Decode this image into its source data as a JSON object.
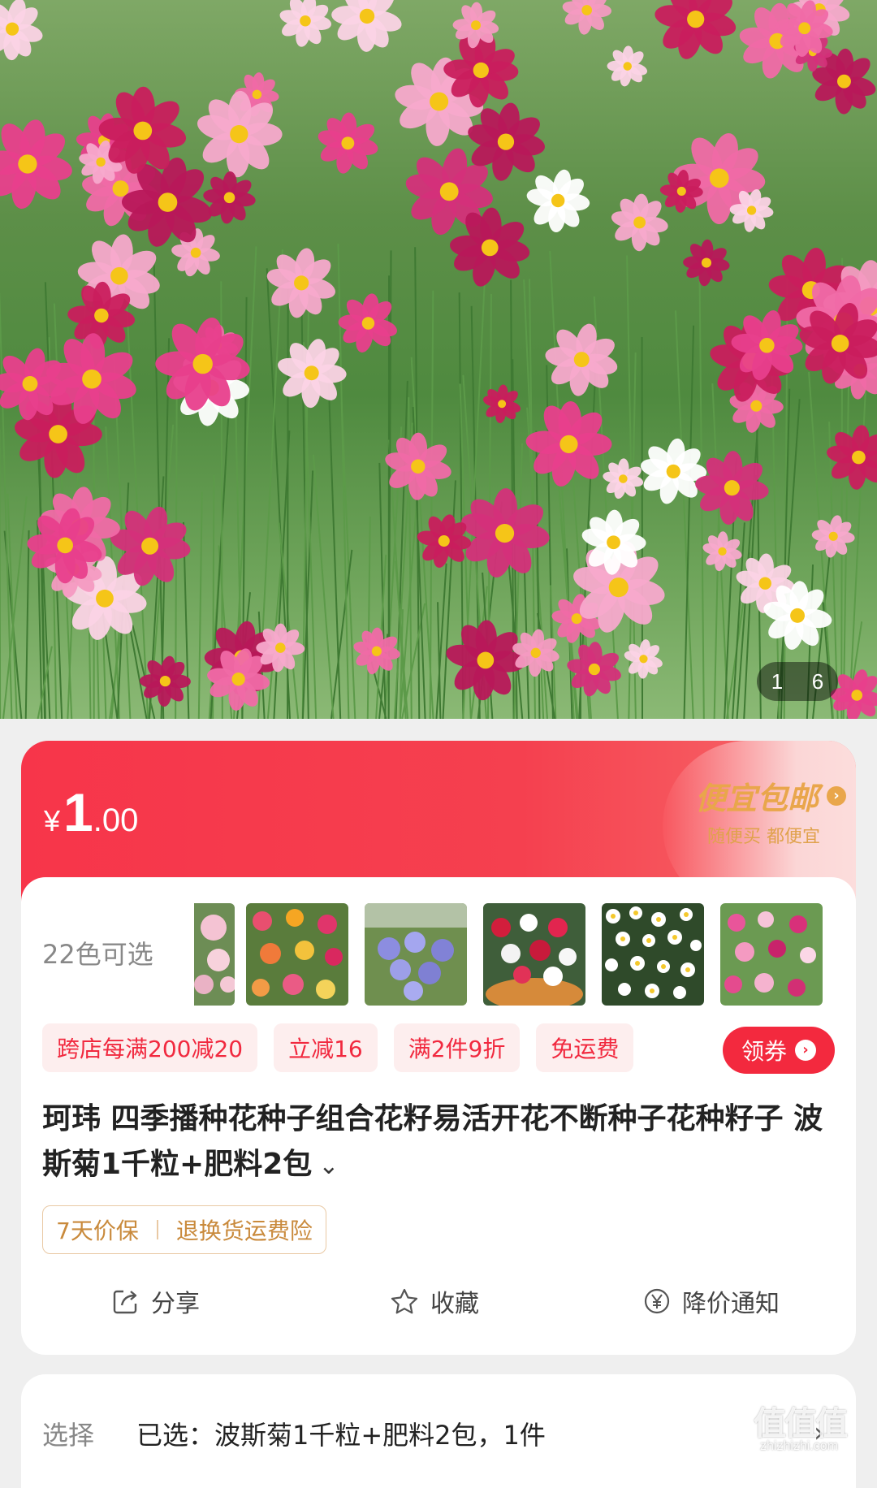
{
  "gallery": {
    "current": "1",
    "total": "6"
  },
  "price": {
    "currency": "¥",
    "integer": "1",
    "decimal": ".00"
  },
  "promo": {
    "title": "便宜包邮",
    "subtitle": "随便买 都便宜"
  },
  "colors": {
    "label": "22色可选"
  },
  "tags": [
    "跨店每满200减20",
    "立减16",
    "满2件9折",
    "免运费"
  ],
  "coupon_label": "领券",
  "product_title": "珂玮 四季播种花种子组合花籽易活开花不断种子花种籽子 波斯菊1千粒+肥料2包",
  "guarantees": [
    "7天价保",
    "退换货运费险"
  ],
  "actions": {
    "share": "分享",
    "favorite": "收藏",
    "price_alert": "降价通知"
  },
  "selection": {
    "label": "选择",
    "value": "已选：波斯菊1千粒+肥料2包，1件"
  },
  "watermark": {
    "main": "值值值",
    "url": "zhizhizhi.com"
  },
  "accent_color": "#f3293e"
}
